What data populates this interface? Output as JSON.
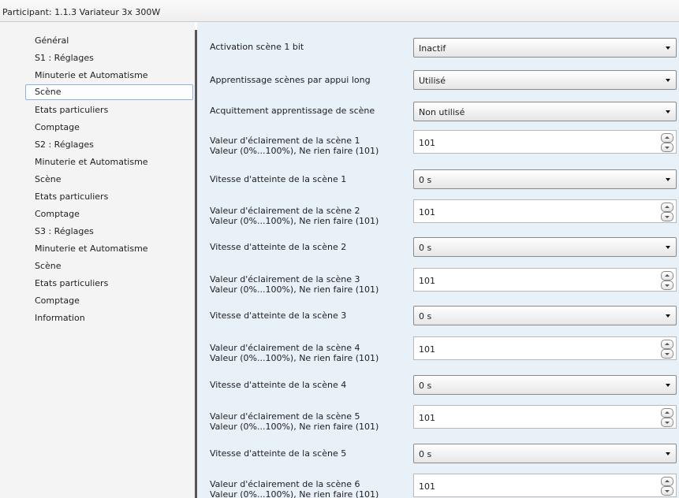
{
  "window": {
    "title": "Participant: 1.1.3  Variateur 3x 300W"
  },
  "sidebar": {
    "items": [
      {
        "label": "Général"
      },
      {
        "label": "S1 : Réglages"
      },
      {
        "label": "Minuterie et Automatisme"
      },
      {
        "label": "Scène",
        "selected": true
      },
      {
        "label": "Etats particuliers"
      },
      {
        "label": "Comptage"
      },
      {
        "label": "S2 : Réglages"
      },
      {
        "label": "Minuterie et Automatisme"
      },
      {
        "label": "Scène"
      },
      {
        "label": "Etats particuliers"
      },
      {
        "label": "Comptage"
      },
      {
        "label": "S3 : Réglages"
      },
      {
        "label": "Minuterie et Automatisme"
      },
      {
        "label": "Scène"
      },
      {
        "label": "Etats particuliers"
      },
      {
        "label": "Comptage"
      },
      {
        "label": "Information"
      }
    ]
  },
  "params": [
    {
      "label": "Activation scène 1 bit",
      "type": "combo",
      "value": "Inactif"
    },
    {
      "label": "Apprentissage scènes par appui long",
      "type": "combo",
      "value": "Utilisé"
    },
    {
      "label": "Acquittement apprentissage de scène",
      "type": "combo",
      "value": "Non utilisé"
    },
    {
      "label": "Valeur d'éclairement de la scène 1",
      "label2": "Valeur (0%...100%), Ne rien faire (101)",
      "type": "spinner",
      "value": "101"
    },
    {
      "label": "Vitesse d'atteinte de la scène 1",
      "type": "combo",
      "value": "0 s"
    },
    {
      "label": "Valeur d'éclairement de la scène 2",
      "label2": "Valeur (0%...100%), Ne rien faire (101)",
      "type": "spinner",
      "value": "101"
    },
    {
      "label": "Vitesse d'atteinte de la scène 2",
      "type": "combo",
      "value": "0 s"
    },
    {
      "label": "Valeur d'éclairement de la scène 3",
      "label2": "Valeur (0%...100%), Ne rien faire (101)",
      "type": "spinner",
      "value": "101"
    },
    {
      "label": "Vitesse d'atteinte de la scène 3",
      "type": "combo",
      "value": "0 s"
    },
    {
      "label": "Valeur d'éclairement de la scène 4",
      "label2": "Valeur (0%...100%), Ne rien faire (101)",
      "type": "spinner",
      "value": "101"
    },
    {
      "label": "Vitesse d'atteinte de la scène 4",
      "type": "combo",
      "value": "0 s"
    },
    {
      "label": "Valeur d'éclairement de la scène 5",
      "label2": "Valeur (0%...100%), Ne rien faire (101)",
      "type": "spinner",
      "value": "101"
    },
    {
      "label": "Vitesse d'atteinte de la scène 5",
      "type": "combo",
      "value": "0 s"
    },
    {
      "label": "Valeur d'éclairement de la scène 6",
      "label2": "Valeur (0%...100%), Ne rien faire (101)",
      "type": "spinner",
      "value": "101"
    }
  ]
}
